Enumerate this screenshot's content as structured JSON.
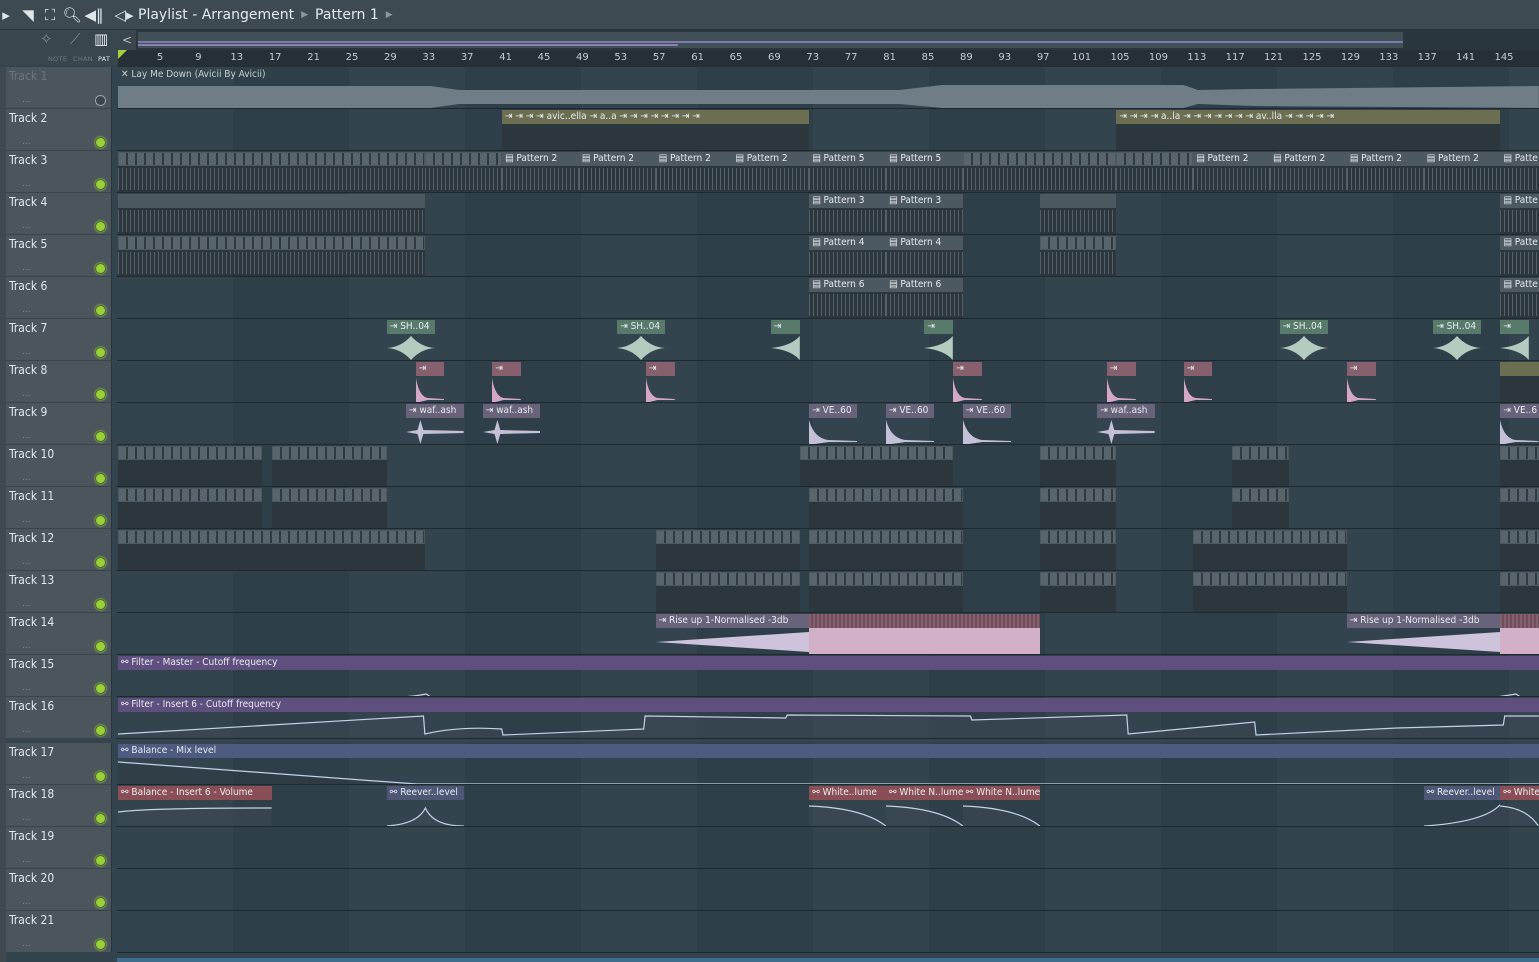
{
  "window": {
    "title_icons": [
      "arrow-icon",
      "paint-icon",
      "fullscreen-icon",
      "zoom-icon",
      "speaker-icon"
    ],
    "breadcrumb": [
      {
        "label": "Playlist - Arrangement"
      },
      {
        "label": "Pattern 1"
      }
    ]
  },
  "header": {
    "tools": [
      {
        "icon": "note-icon",
        "label": "NOTE"
      },
      {
        "icon": "channel-icon",
        "label": "CHAN"
      },
      {
        "icon": "pattern-icon",
        "label": "PAT"
      }
    ],
    "overview_back": "<"
  },
  "ruler": {
    "ticks": [
      "5",
      "9",
      "13",
      "17",
      "21",
      "25",
      "29",
      "33",
      "37",
      "41",
      "45",
      "49",
      "53",
      "57",
      "61",
      "65",
      "69",
      "73",
      "77",
      "81",
      "85",
      "89",
      "93",
      "97",
      "101",
      "105",
      "109",
      "113",
      "117",
      "121",
      "125",
      "129",
      "133",
      "137",
      "141",
      "145"
    ]
  },
  "tracks": [
    {
      "name": "Track 1",
      "dim": true,
      "led": "off"
    },
    {
      "name": "Track 2"
    },
    {
      "name": "Track 3"
    },
    {
      "name": "Track 4"
    },
    {
      "name": "Track 5"
    },
    {
      "name": "Track 6"
    },
    {
      "name": "Track 7"
    },
    {
      "name": "Track 8"
    },
    {
      "name": "Track 9"
    },
    {
      "name": "Track 10"
    },
    {
      "name": "Track 11"
    },
    {
      "name": "Track 12"
    },
    {
      "name": "Track 13"
    },
    {
      "name": "Track 14"
    },
    {
      "name": "Track 15"
    },
    {
      "name": "Track 16"
    },
    {
      "name": "Track 17"
    },
    {
      "name": "Track 18"
    },
    {
      "name": "Track 19"
    },
    {
      "name": "Track 20"
    },
    {
      "name": "Track 21"
    }
  ],
  "track_menu": "...",
  "clips": {
    "track1": {
      "label": "Lay Me Down (Avicii By Avicii)"
    },
    "track2": [
      {
        "label": "avic..ella"
      },
      {
        "label": "a..a"
      },
      {
        "label": "a..la"
      },
      {
        "label": "av..lla"
      }
    ],
    "track3": {
      "label": "Pattern 2",
      "alt": "Pattern 5"
    },
    "track4": {
      "label": "Pattern 3"
    },
    "track5": {
      "label": "Pattern 4"
    },
    "track6": {
      "label": "Pattern 6"
    },
    "track7": {
      "label": "SH..04"
    },
    "track9": [
      {
        "label": "waf..ash"
      },
      {
        "label": "VE..60"
      }
    ],
    "track14": {
      "label": "Rise up 1-Normalised -3db"
    },
    "track15": {
      "label": "Filter - Master - Cutoff frequency"
    },
    "track16": {
      "label": "Filter - Insert 6 - Cutoff frequency"
    },
    "track17": {
      "label": "Balance - Mix level"
    },
    "track18": [
      {
        "label": "Balance - Insert 6 - Volume"
      },
      {
        "label": "Reever..level"
      },
      {
        "label": "White..lume"
      },
      {
        "label": "White N..lume"
      },
      {
        "label": "White"
      }
    ],
    "pattern_truncated": "Patte",
    "ve_truncated": "VE..6"
  }
}
